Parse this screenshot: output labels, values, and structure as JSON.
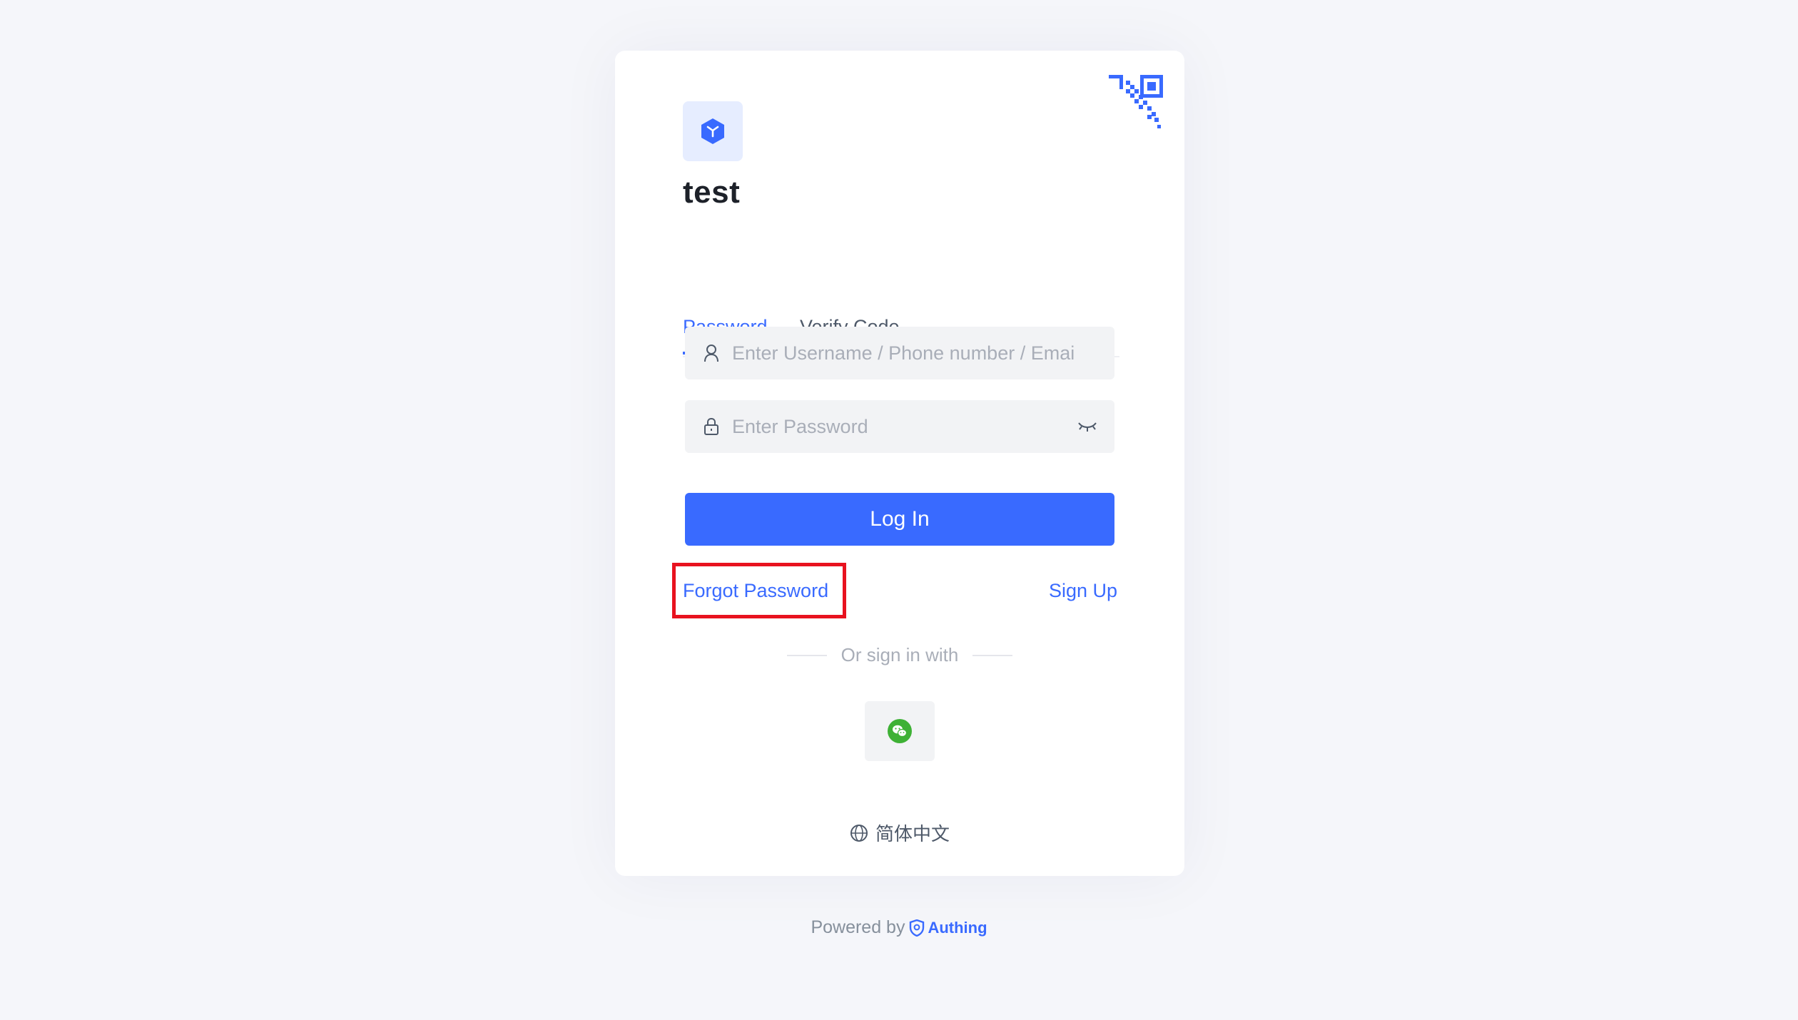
{
  "app": {
    "name": "test"
  },
  "tabs": [
    {
      "label": "Password",
      "active": true
    },
    {
      "label": "Verify Code",
      "active": false
    }
  ],
  "form": {
    "username_placeholder": "Enter Username / Phone number / Email",
    "password_placeholder": "Enter Password",
    "login_label": "Log In"
  },
  "links": {
    "forgot_password": "Forgot Password",
    "sign_up": "Sign Up"
  },
  "social": {
    "divider_text": "Or sign in with",
    "providers": [
      "wechat-icon"
    ]
  },
  "language": {
    "current": "简体中文"
  },
  "footer": {
    "powered_by": "Powered by",
    "brand": "Authing"
  },
  "colors": {
    "accent": "#396aff",
    "highlight": "#e8121f",
    "wechat": "#3eb135",
    "background": "#f5f6fa"
  },
  "icons": [
    "qr-code-icon",
    "cube-logo-icon",
    "user-icon",
    "lock-icon",
    "eye-closed-icon",
    "wechat-icon",
    "globe-icon",
    "shield-icon"
  ]
}
